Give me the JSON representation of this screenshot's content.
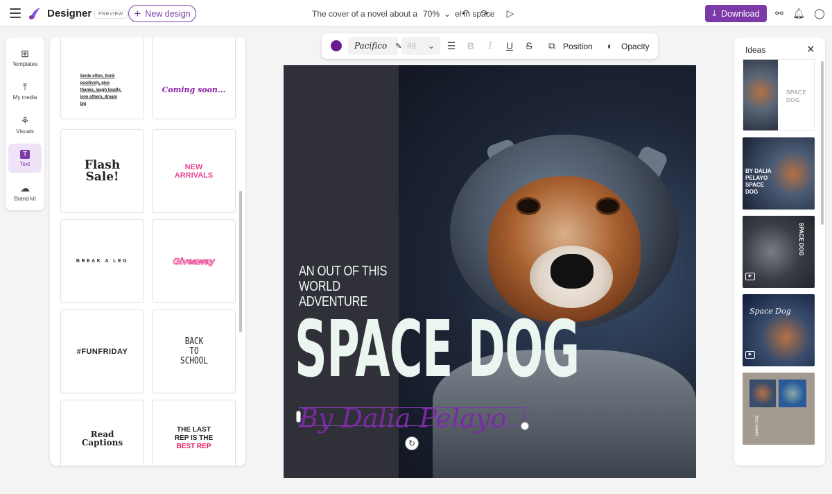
{
  "app": {
    "menu_icon": "hamburger-menu-icon",
    "logo_icon": "designer-logo-icon",
    "name": "Designer",
    "badge": "PREVIEW",
    "new_design_label": "New design",
    "prompt_text": "The cover of a novel about a do",
    "zoom": "70%",
    "prompt_tail": "el in space",
    "download_label": "Download",
    "accent": "#7c3aa8"
  },
  "rail": {
    "items": [
      {
        "label": "Templates",
        "icon": "templates-icon"
      },
      {
        "label": "My media",
        "icon": "upload-icon"
      },
      {
        "label": "Visuals",
        "icon": "visuals-icon"
      },
      {
        "label": "Text",
        "icon": "text-icon",
        "active": true
      },
      {
        "label": "Brand kit",
        "icon": "brand-kit-icon"
      }
    ]
  },
  "text_templates": [
    {
      "text": "Smile often, think positively, give thanks, laugh loudly, love others, dream big"
    },
    {
      "text": "Coming soon..."
    },
    {
      "text": "Flash Sale!"
    },
    {
      "text": "NEW ARRIVALS"
    },
    {
      "text": "BREAK A LEG"
    },
    {
      "text": "Giveaway"
    },
    {
      "text": "#FUNFRIDAY"
    },
    {
      "text": "BACK TO SCHOOL"
    },
    {
      "text": "Read Captions"
    },
    {
      "line1": "THE LAST",
      "line2": "REP IS THE",
      "line3": "BEST REP"
    }
  ],
  "format_toolbar": {
    "color": "#6a1b8f",
    "font": "Pacifico",
    "size": "48",
    "position_label": "Position",
    "opacity_label": "Opacity"
  },
  "canvas": {
    "subtitle": "AN OUT OF THIS WORLD ADVENTURE",
    "title": "SPACE DOG",
    "author": "By Dalia Pelayo"
  },
  "ideas": {
    "title": "Ideas",
    "thumbs": [
      {
        "text": "SPACE DOG"
      },
      {
        "text": "BY DALIA PELAYO SPACE DOG"
      },
      {
        "text": "SPACE DOG"
      },
      {
        "text": "Space Dog"
      },
      {
        "text": "Space Dog"
      }
    ]
  }
}
